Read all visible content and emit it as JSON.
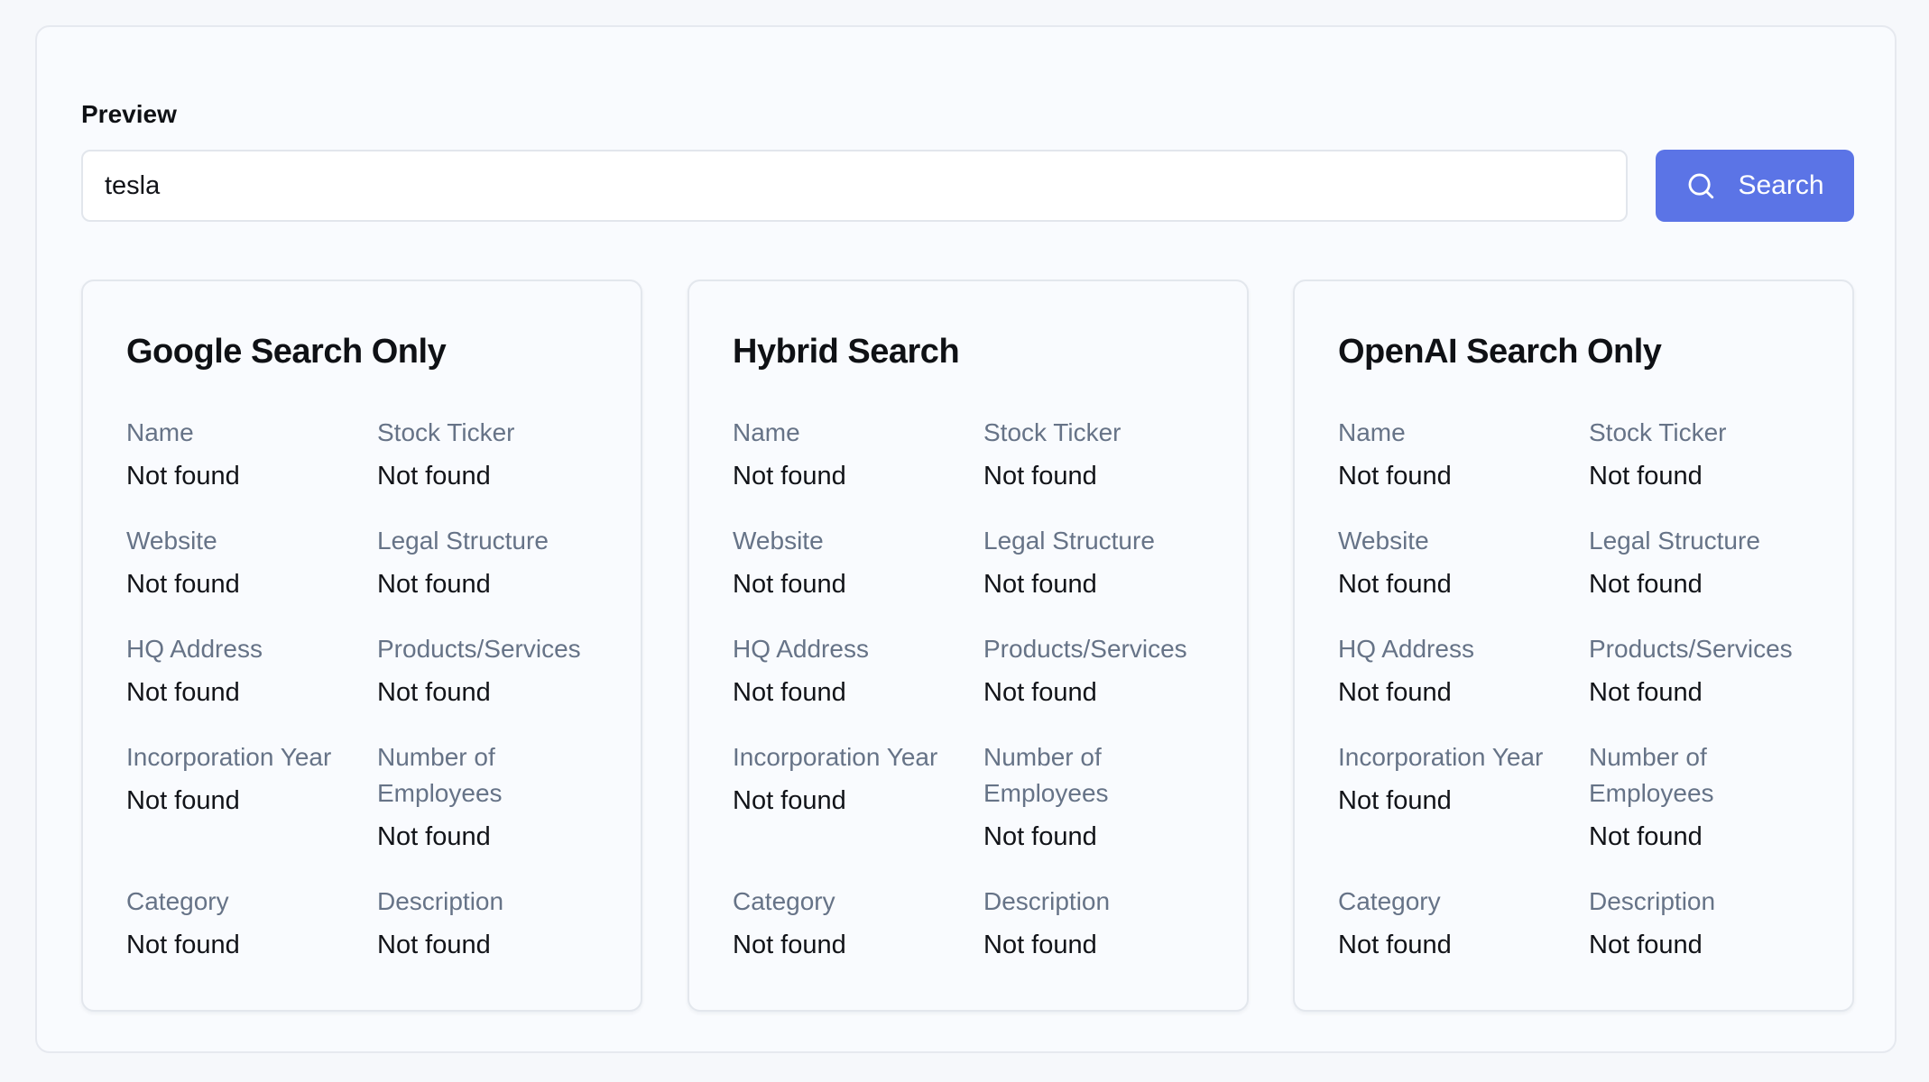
{
  "preview": {
    "title": "Preview"
  },
  "search": {
    "value": "tesla",
    "button_label": "Search",
    "icon": "search-icon",
    "accent_color": "#5b74e6"
  },
  "cards": [
    {
      "title": "Google Search Only",
      "fields": [
        {
          "label": "Name",
          "value": "Not found"
        },
        {
          "label": "Stock Ticker",
          "value": "Not found"
        },
        {
          "label": "Website",
          "value": "Not found"
        },
        {
          "label": "Legal Structure",
          "value": "Not found"
        },
        {
          "label": "HQ Address",
          "value": "Not found"
        },
        {
          "label": "Products/Services",
          "value": "Not found"
        },
        {
          "label": "Incorporation Year",
          "value": "Not found"
        },
        {
          "label": "Number of Employees",
          "value": "Not found"
        },
        {
          "label": "Category",
          "value": "Not found"
        },
        {
          "label": "Description",
          "value": "Not found"
        }
      ]
    },
    {
      "title": "Hybrid Search",
      "fields": [
        {
          "label": "Name",
          "value": "Not found"
        },
        {
          "label": "Stock Ticker",
          "value": "Not found"
        },
        {
          "label": "Website",
          "value": "Not found"
        },
        {
          "label": "Legal Structure",
          "value": "Not found"
        },
        {
          "label": "HQ Address",
          "value": "Not found"
        },
        {
          "label": "Products/Services",
          "value": "Not found"
        },
        {
          "label": "Incorporation Year",
          "value": "Not found"
        },
        {
          "label": "Number of Employees",
          "value": "Not found"
        },
        {
          "label": "Category",
          "value": "Not found"
        },
        {
          "label": "Description",
          "value": "Not found"
        }
      ]
    },
    {
      "title": "OpenAI Search Only",
      "fields": [
        {
          "label": "Name",
          "value": "Not found"
        },
        {
          "label": "Stock Ticker",
          "value": "Not found"
        },
        {
          "label": "Website",
          "value": "Not found"
        },
        {
          "label": "Legal Structure",
          "value": "Not found"
        },
        {
          "label": "HQ Address",
          "value": "Not found"
        },
        {
          "label": "Products/Services",
          "value": "Not found"
        },
        {
          "label": "Incorporation Year",
          "value": "Not found"
        },
        {
          "label": "Number of Employees",
          "value": "Not found"
        },
        {
          "label": "Category",
          "value": "Not found"
        },
        {
          "label": "Description",
          "value": "Not found"
        }
      ]
    }
  ]
}
